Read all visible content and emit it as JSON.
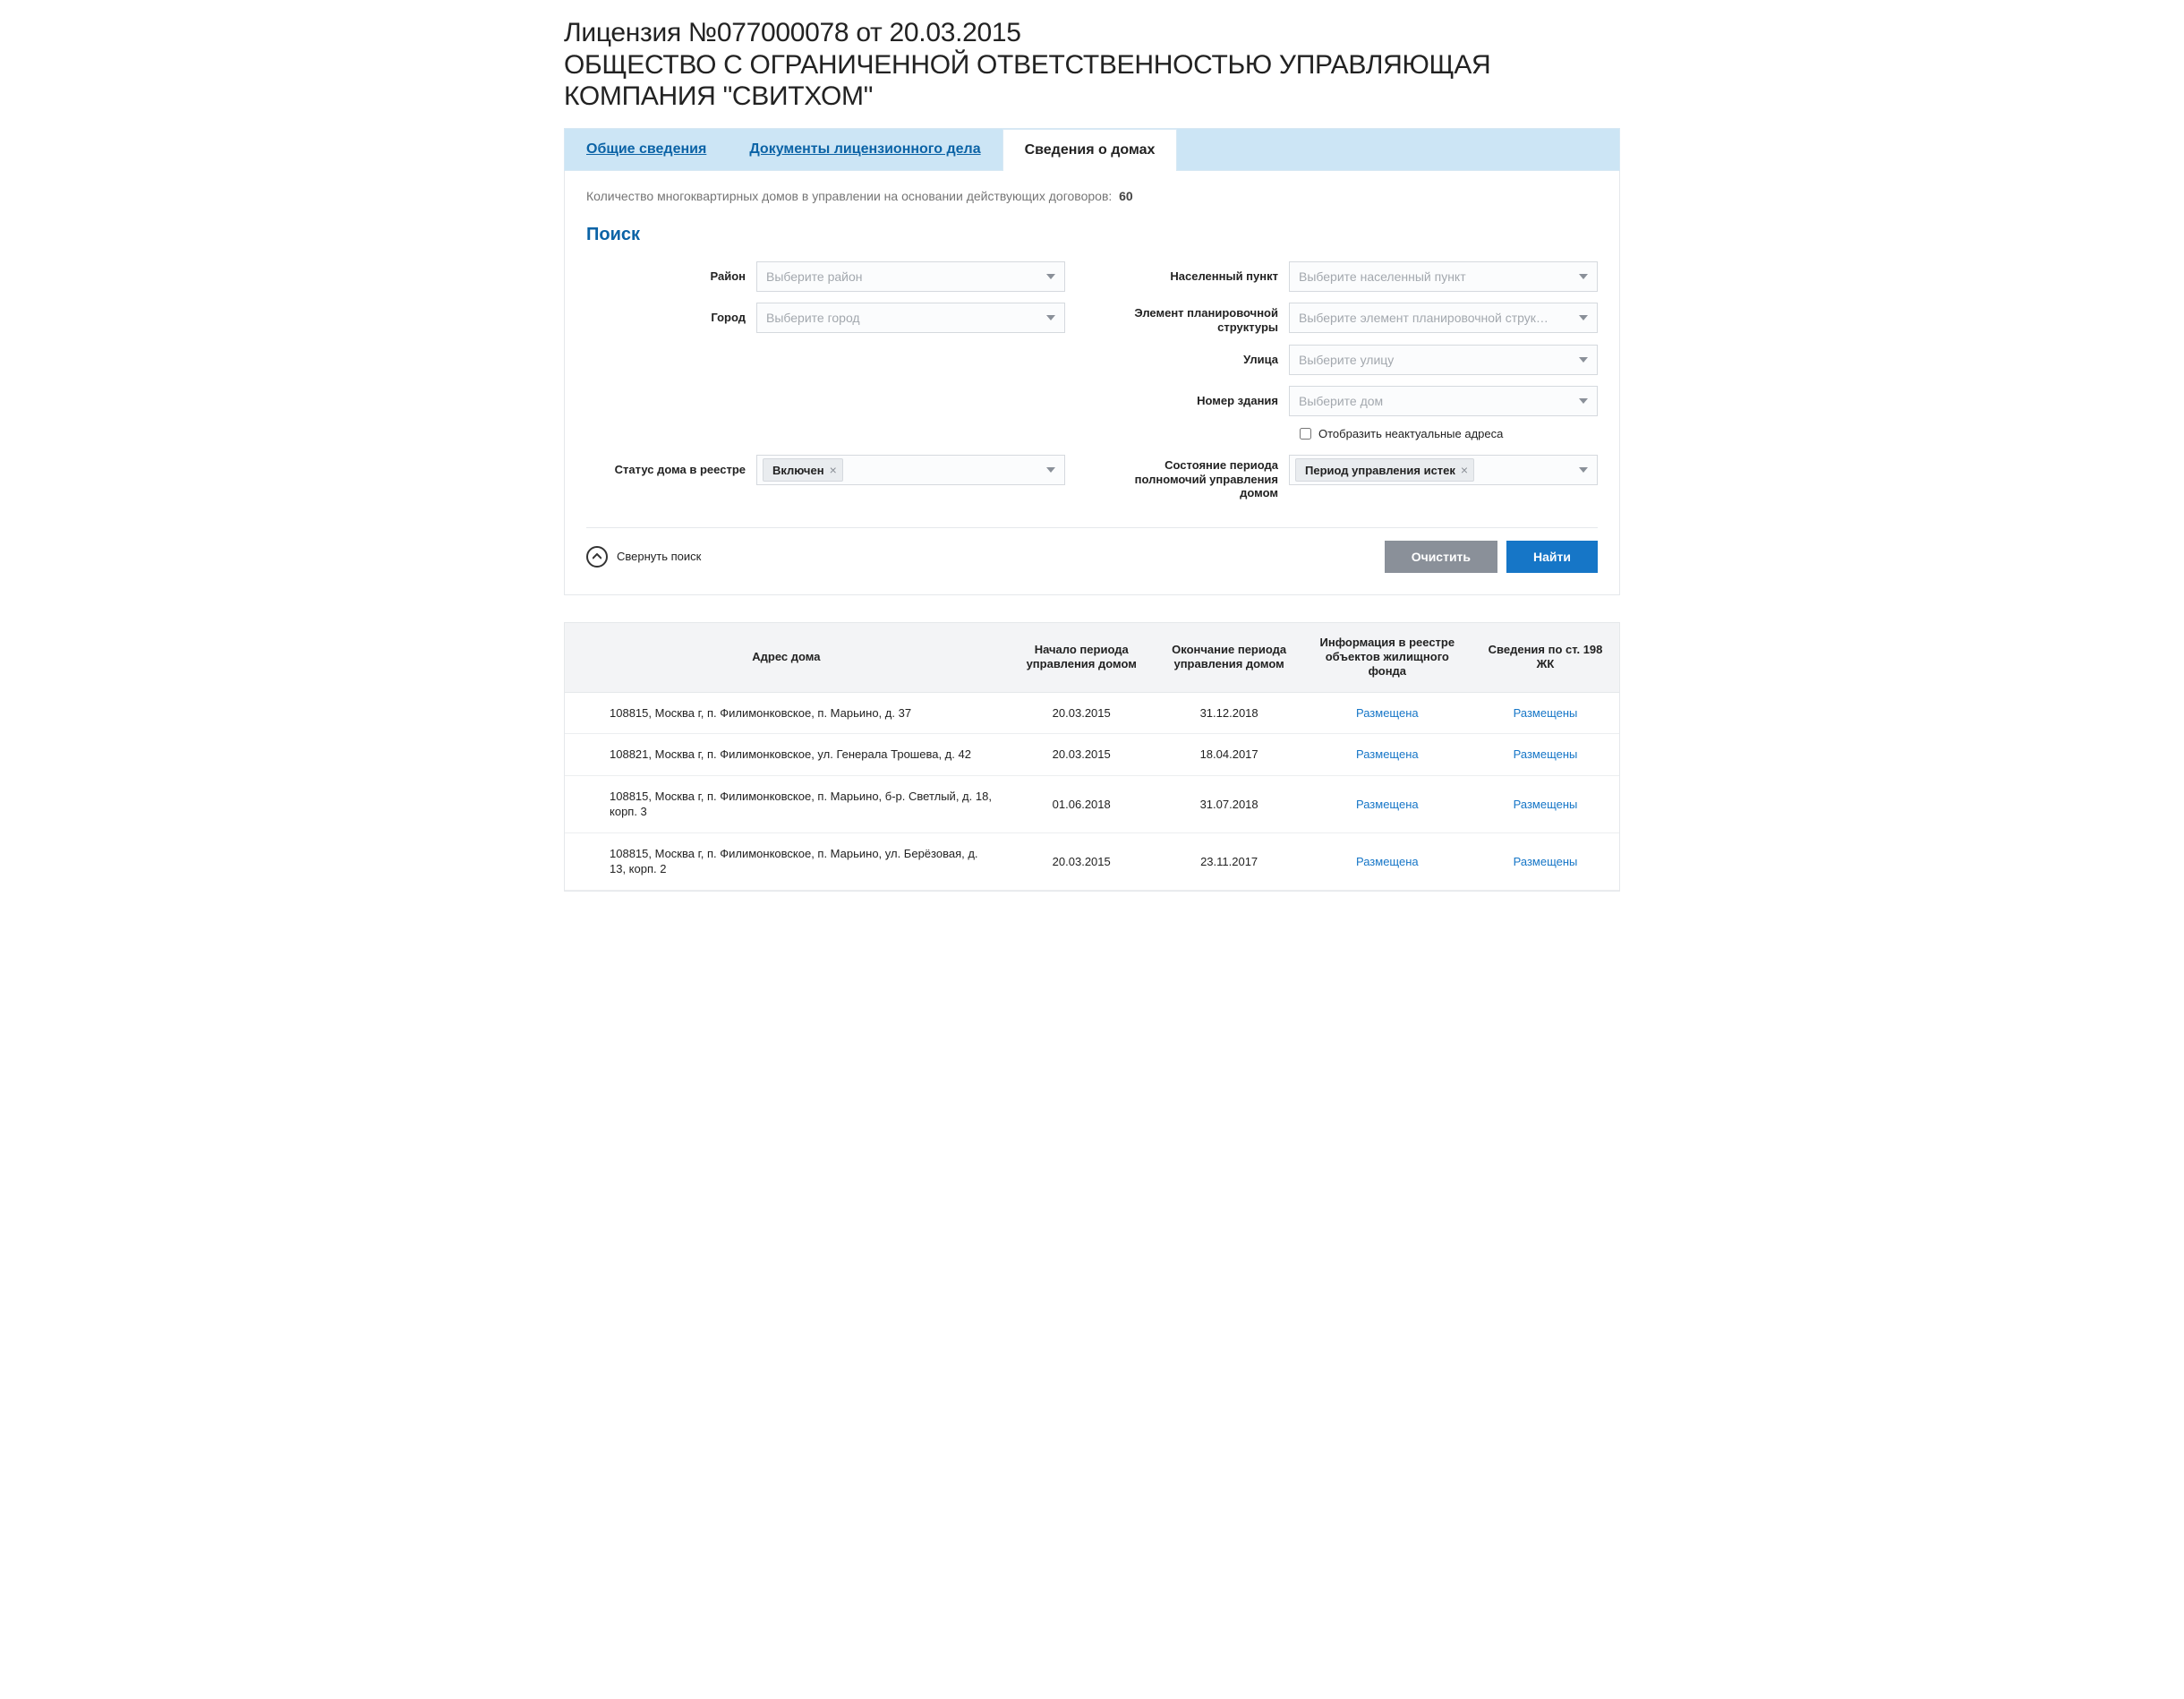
{
  "header": {
    "title_line1": "Лицензия №077000078 от 20.03.2015",
    "title_line2": "ОБЩЕСТВО С ОГРАНИЧЕННОЙ ОТВЕТСТВЕННОСТЬЮ УПРАВЛЯЮЩАЯ КОМПАНИЯ \"СВИТХОМ\""
  },
  "tabs": {
    "general": "Общие сведения",
    "documents": "Документы лицензионного дела",
    "houses": "Сведения о домах"
  },
  "houses_panel": {
    "count_label": "Количество многоквартирных домов в управлении на основании действующих договоров:",
    "count_value": "60",
    "search_title": "Поиск",
    "labels": {
      "district": "Район",
      "city": "Город",
      "settlement": "Населенный пункт",
      "planning_el": "Элемент планировочной структуры",
      "street": "Улица",
      "building_no": "Номер здания",
      "status": "Статус дома в реестре",
      "period_state": "Состояние периода полномочий управления домом"
    },
    "placeholders": {
      "district": "Выберите район",
      "city": "Выберите город",
      "settlement": "Выберите населенный пункт",
      "planning_el": "Выберите элемент планировочной струк…",
      "street": "Выберите улицу",
      "building_no": "Выберите дом"
    },
    "checkbox_label": "Отобразить неактуальные адреса",
    "status_chip": "Включен",
    "period_chip": "Период управления истек",
    "collapse_label": "Свернуть поиск",
    "btn_clear": "Очистить",
    "btn_find": "Найти"
  },
  "table": {
    "headers": {
      "address": "Адрес дома",
      "period_start": "Начало периода управления домом",
      "period_end": "Окончание периода управления домом",
      "registry_info": "Информация в реестре объектов жилищного фонда",
      "art198": "Сведения по ст. 198 ЖК"
    },
    "link_placed_f": "Размещена",
    "link_placed_pl": "Размещены",
    "rows": [
      {
        "address": "108815, Москва г, п. Филимонковское, п. Марьино, д. 37",
        "start": "20.03.2015",
        "end": "31.12.2018"
      },
      {
        "address": "108821, Москва г, п. Филимонковское, ул. Генерала Трошева, д. 42",
        "start": "20.03.2015",
        "end": "18.04.2017"
      },
      {
        "address": "108815, Москва г, п. Филимонковское, п. Марьино, б-р. Светлый, д. 18, корп. 3",
        "start": "01.06.2018",
        "end": "31.07.2018"
      },
      {
        "address": "108815, Москва г, п. Филимонковское, п. Марьино, ул. Берёзовая, д. 13, корп. 2",
        "start": "20.03.2015",
        "end": "23.11.2017"
      }
    ]
  }
}
